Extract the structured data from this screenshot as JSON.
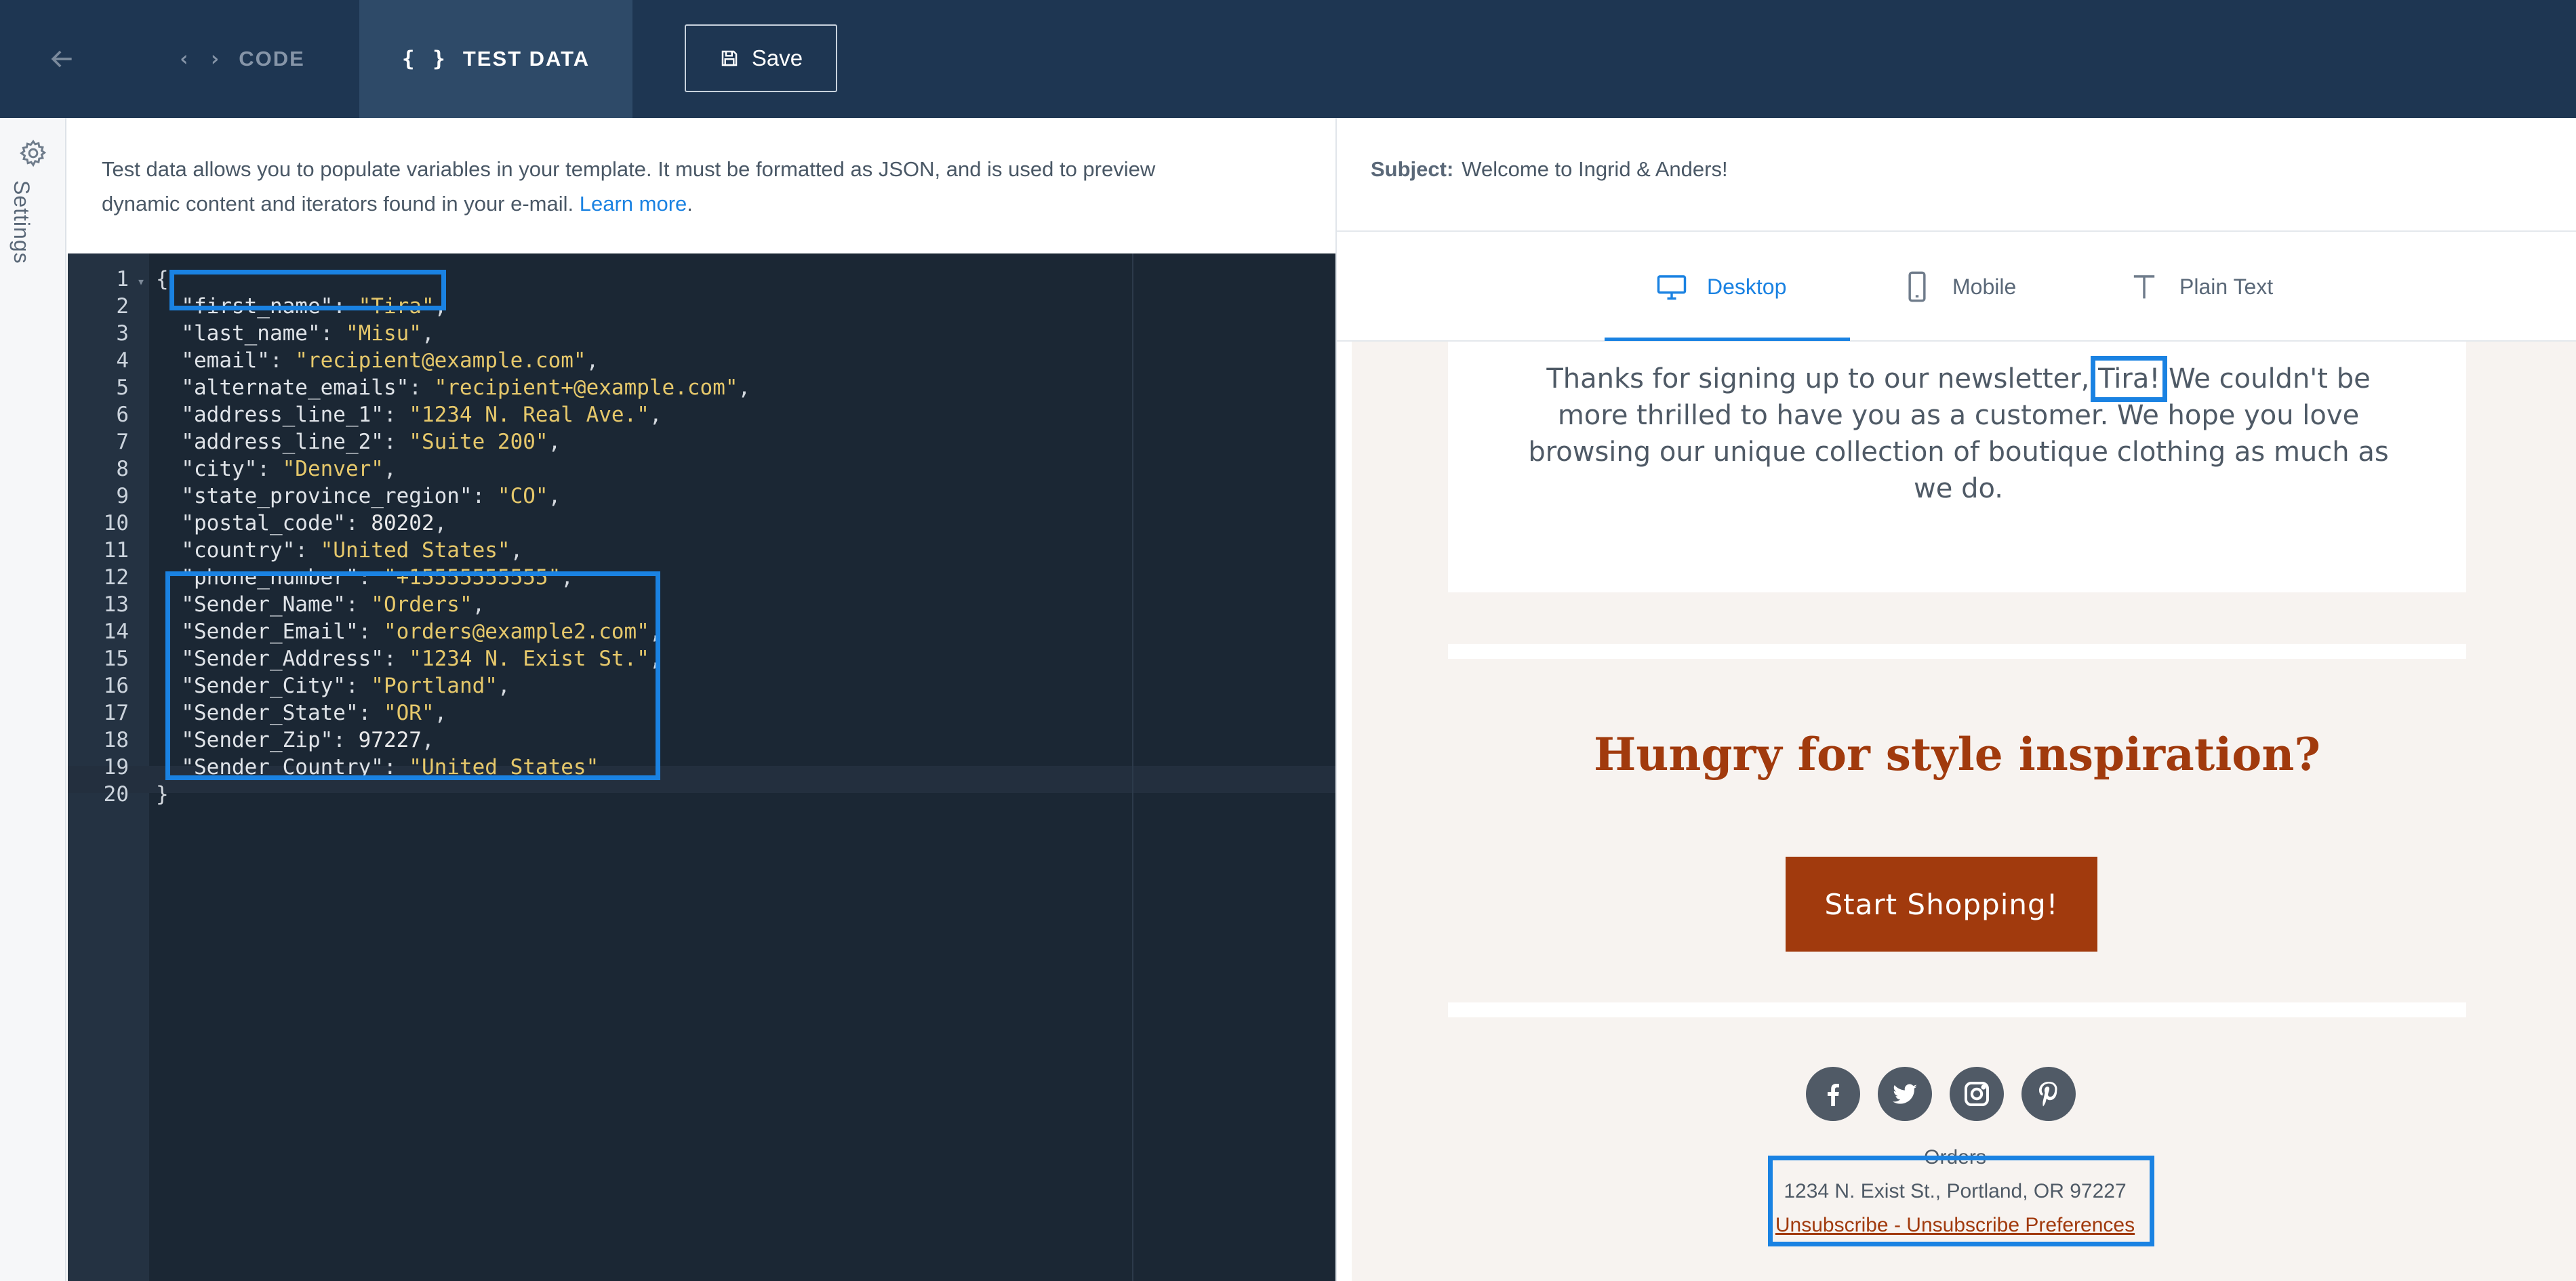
{
  "toolbar": {
    "code_tab": "CODE",
    "test_data_tab": "TEST DATA",
    "code_icon": "‹ ›",
    "test_data_icon": "{ }",
    "save_label": "Save"
  },
  "rail": {
    "label": "Settings"
  },
  "info": {
    "text_line1": "Test data allows you to populate variables in your template. It must be formatted as JSON, and is used to preview",
    "text_line2": "dynamic content and iterators found in your e-mail.",
    "link": "Learn more",
    "period": "."
  },
  "editor": {
    "lines": [
      "{",
      "  \"first_name\": \"Tira\",",
      "  \"last_name\": \"Misu\",",
      "  \"email\": \"recipient@example.com\",",
      "  \"alternate_emails\": \"recipient+@example.com\",",
      "  \"address_line_1\": \"1234 N. Real Ave.\",",
      "  \"address_line_2\": \"Suite 200\",",
      "  \"city\": \"Denver\",",
      "  \"state_province_region\": \"CO\",",
      "  \"postal_code\": 80202,",
      "  \"country\": \"United States\",",
      "  \"phone_number\": \"+15555555555\",",
      "  \"Sender_Name\": \"Orders\",",
      "  \"Sender_Email\": \"orders@example2.com\",",
      "  \"Sender_Address\": \"1234 N. Exist St.\",",
      "  \"Sender_City\": \"Portland\",",
      "  \"Sender_State\": \"OR\",",
      "  \"Sender_Zip\": 97227,",
      "  \"Sender_Country\": \"United States\"",
      "}"
    ]
  },
  "preview": {
    "subject_label": "Subject:",
    "subject_value": "Welcome to Ingrid & Anders!",
    "tabs": [
      "Desktop",
      "Mobile",
      "Plain Text"
    ],
    "active_tab": "Desktop",
    "intro_before": "Thanks for signing up to our newsletter, ",
    "intro_name": "Tira!",
    "intro_after": " We couldn't be more thrilled to have you as a customer. We hope you love browsing our unique collection of boutique clothing as much as we do.",
    "headline": "Hungry for style inspiration?",
    "cta": "Start Shopping!",
    "social_icons": [
      "facebook-icon",
      "twitter-icon",
      "instagram-icon",
      "pinterest-icon"
    ],
    "footer_name": "Orders",
    "footer_address": "1234 N. Exist St., Portland, OR 97227",
    "footer_links": "Unsubscribe - Unsubscribe Preferences"
  },
  "colors": {
    "topbar": "#1e3652",
    "accent": "#1a82e2",
    "brand": "#a13a0d",
    "editor_bg": "#1b2734",
    "string": "#e6c86b"
  }
}
